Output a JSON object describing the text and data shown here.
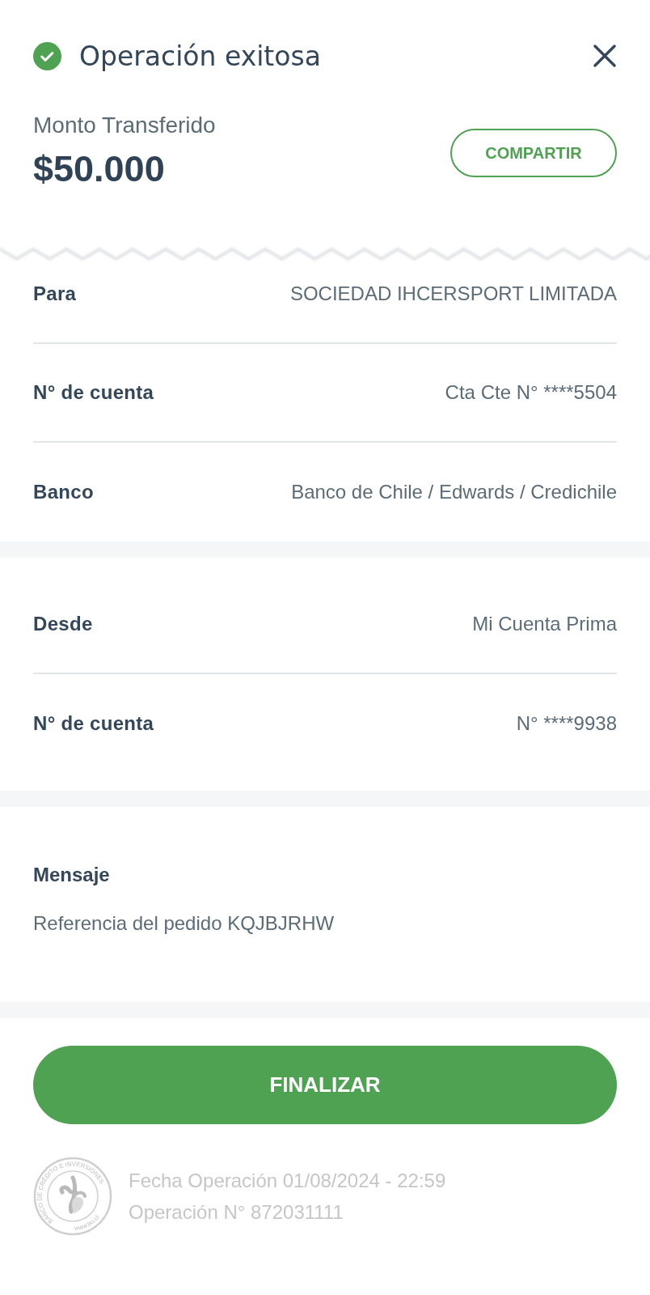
{
  "header": {
    "title": "Operación exitosa",
    "amount_label": "Monto Transferido",
    "amount": "$50.000",
    "share_button": "COMPARTIR"
  },
  "sections": [
    {
      "rows": [
        {
          "label": "Para",
          "value": "SOCIEDAD IHCERSPORT LIMITADA"
        },
        {
          "label": "N° de cuenta",
          "value": "Cta Cte N° ****5504"
        },
        {
          "label": "Banco",
          "value": "Banco de Chile / Edwards / Credichile"
        }
      ]
    },
    {
      "rows": [
        {
          "label": "Desde",
          "value": "Mi Cuenta Prima"
        },
        {
          "label": "N° de cuenta",
          "value": "N° ****9938"
        }
      ]
    }
  ],
  "message": {
    "label": "Mensaje",
    "text": "Referencia del pedido KQJBJRHW"
  },
  "finish_button": "FINALIZAR",
  "footer": {
    "seal": {
      "name": "BANCO DE CRÉDITO E INVERSIONES",
      "url": "www.bci.cl"
    },
    "date": "Fecha Operación 01/08/2024 - 22:59",
    "operation": "Operación N° 872031111"
  }
}
